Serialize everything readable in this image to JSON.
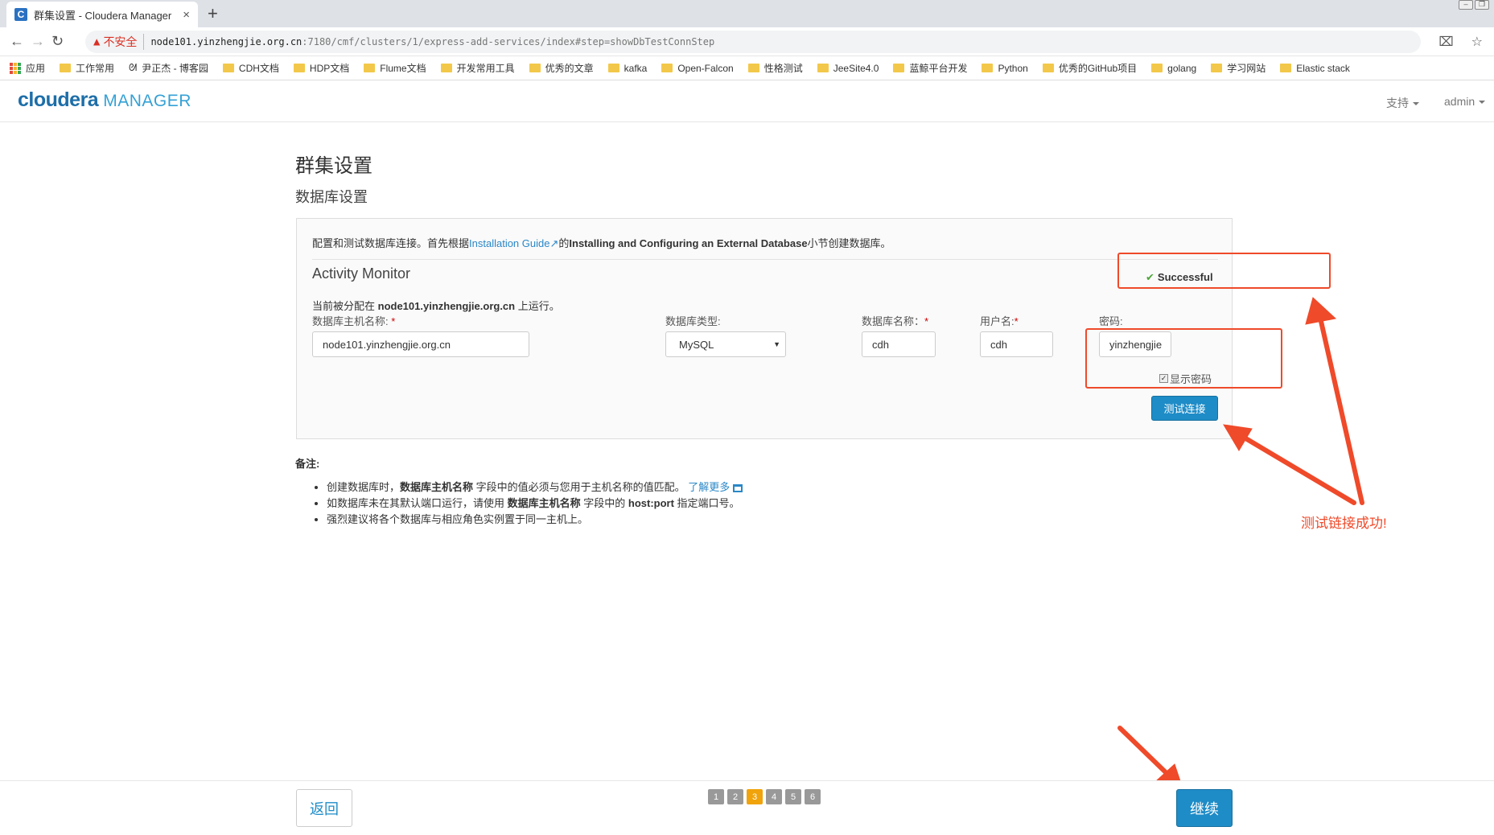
{
  "browser": {
    "tab_title": "群集设置 - Cloudera Manager",
    "tab_favicon": "C",
    "tab_close": "×",
    "new_tab": "+",
    "security_label": "不安全",
    "url_host": "node101.yinzhengjie.org.cn",
    "url_path": ":7180/cmf/clusters/1/express-add-services/index#step=showDbTestConnStep",
    "back_icon": "←",
    "forward_icon": "→",
    "reload_icon": "↻",
    "translate_icon": "⌧",
    "star_icon": "☆"
  },
  "bookmarks": {
    "apps": "应用",
    "items": [
      "工作常用",
      "尹正杰 - 博客园",
      "CDH文档",
      "HDP文档",
      "Flume文档",
      "开发常用工具",
      "优秀的文章",
      "kafka",
      "Open-Falcon",
      "性格测试",
      "JeeSite4.0",
      "蓝鲸平台开发",
      "Python",
      "优秀的GitHub项目",
      "golang",
      "学习网站",
      "Elastic stack"
    ]
  },
  "header": {
    "logo_main": "cloudera",
    "logo_sub": "MANAGER",
    "support": "支持",
    "user": "admin"
  },
  "page": {
    "title": "群集设置",
    "subtitle": "数据库设置"
  },
  "panel": {
    "intro_pre": "配置和测试数据库连接。首先根据",
    "intro_link": "Installation Guide",
    "intro_ext_icon": "↗",
    "intro_mid": "的",
    "intro_bold": "Installing and Configuring an External Database",
    "intro_post": "小节创建数据库。",
    "section_title": "Activity Monitor",
    "success_icon": "✔",
    "success_text": "Successful",
    "assigned_pre": "当前被分配在 ",
    "assigned_host": "node101.yinzhengjie.org.cn",
    "assigned_post": " 上运行。",
    "required_mark": "*",
    "fields": {
      "host_label": "数据库主机名称:",
      "host_value": "node101.yinzhengjie.org.cn",
      "type_label": "数据库类型:",
      "type_value": "MySQL",
      "type_arrow": "▼",
      "dbname_label": "数据库名称：",
      "dbname_value": "cdh",
      "user_label": "用户名:",
      "user_value": "cdh",
      "password_label": "密码:",
      "password_value": "yinzhengjie"
    },
    "show_password_check": "✓",
    "show_password": "显示密码",
    "test_button": "测试连接"
  },
  "notes": {
    "title": "备注:",
    "n1_pre": "创建数据库时，",
    "n1_bold": "数据库主机名称",
    "n1_post": " 字段中的值必须与您用于主机名称的值匹配。",
    "n1_link": "了解更多",
    "n2_pre": "如数据库未在其默认端口运行，请使用 ",
    "n2_bold1": "数据库主机名称",
    "n2_mid": " 字段中的 ",
    "n2_bold2": "host:port",
    "n2_post": " 指定端口号。",
    "n3": "强烈建议将各个数据库与相应角色实例置于同一主机上。"
  },
  "annotation": {
    "callout": "测试链接成功!",
    "color": "#ef4a2a"
  },
  "footer": {
    "back": "返回",
    "steps": [
      "1",
      "2",
      "3",
      "4",
      "5",
      "6"
    ],
    "active_step": "3",
    "continue": "继续"
  },
  "colors": {
    "primary": "#1e8cc7",
    "step_active": "#f0a30a",
    "success": "#4da53a"
  }
}
